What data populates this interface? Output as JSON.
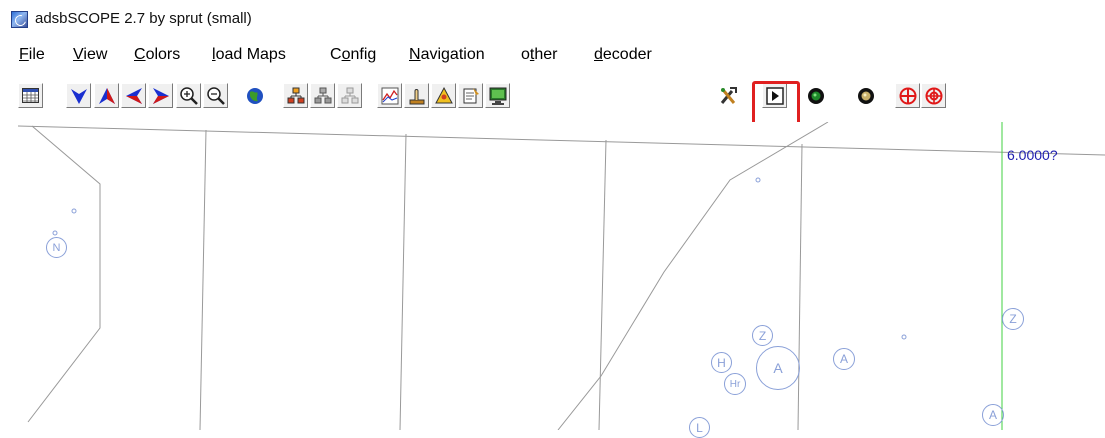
{
  "window": {
    "title": "adsbSCOPE 2.7 by sprut  (small)"
  },
  "menu": [
    {
      "pre": "",
      "ul": "F",
      "post": "ile"
    },
    {
      "pre": "",
      "ul": "V",
      "post": "iew"
    },
    {
      "pre": "",
      "ul": "C",
      "post": "olors"
    },
    {
      "pre": "",
      "ul": "l",
      "post": "oad Maps"
    },
    {
      "pre": "C",
      "ul": "o",
      "post": "nfig"
    },
    {
      "pre": "",
      "ul": "N",
      "post": "avigation"
    },
    {
      "pre": "o",
      "ul": "t",
      "post": "her"
    },
    {
      "pre": "",
      "ul": "d",
      "post": "ecoder"
    }
  ],
  "toolbar": [
    "table-icon",
    "arrow-down-icon",
    "arrow-up-icon",
    "arrow-left-icon",
    "arrow-right-icon",
    "zoom-in-icon",
    "zoom-out-icon",
    "globe-icon",
    "network-icon",
    "network-gray-icon",
    "network-light-icon",
    "chart-icon",
    "hand-icon",
    "warning-icon",
    "document-icon",
    "monitor-icon",
    "tools-icon",
    "play-icon",
    "green-light-icon",
    "yellow-light-icon",
    "crosshair-icon",
    "target-icon"
  ],
  "highlighted_button": "play-icon",
  "map": {
    "label": "6.0000?",
    "aircraft": [
      "N",
      "Z",
      "A",
      "H",
      "Hr",
      "A",
      "Z",
      "A",
      "L"
    ]
  }
}
